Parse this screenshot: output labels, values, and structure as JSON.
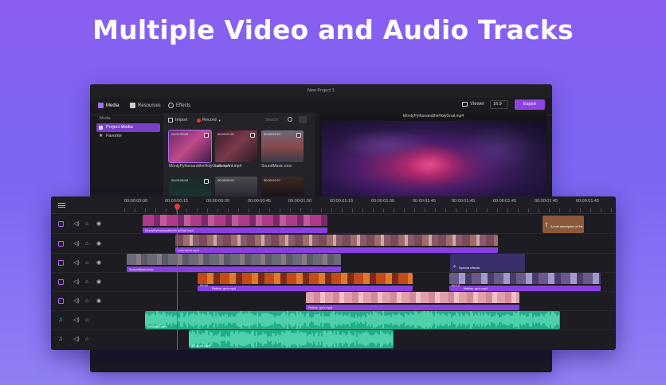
{
  "hero": {
    "title": "Multiple Video and Audio Tracks"
  },
  "window": {
    "title": "New Project 1"
  },
  "toolbar": {
    "tabs": [
      {
        "label": "Media",
        "icon": "media-icon",
        "active": true
      },
      {
        "label": "Resources",
        "icon": "resources-icon",
        "active": false
      },
      {
        "label": "Effects",
        "icon": "effects-icon",
        "active": false
      }
    ],
    "viewer_label": "Viewer",
    "ratio": "16:9",
    "export_label": "Export"
  },
  "sidebar": {
    "heading": "Media",
    "items": [
      {
        "label": "Project Media",
        "icon": "folder-icon",
        "selected": true
      },
      {
        "label": "Favorite",
        "icon": "star-icon",
        "selected": false
      }
    ]
  },
  "media": {
    "import_label": "Import",
    "record_label": "Record",
    "search_placeholder": "Search",
    "items": [
      {
        "time": "00:01:59:09",
        "name": "MontyPythonandtheHolyGrail.mp4",
        "selected": true
      },
      {
        "time": "00:00:01:01",
        "name": "Lola rennt.mp4",
        "selected": false
      },
      {
        "time": "00:00:01:07",
        "name": "SoundMusic.mov",
        "selected": false
      },
      {
        "time": "00:00:08:04",
        "name": "",
        "selected": false
      },
      {
        "time": "00:00:05:07",
        "name": "",
        "selected": false
      },
      {
        "time": "00:00:02:07",
        "name": "",
        "selected": false
      }
    ]
  },
  "preview": {
    "title": "MontyPythonandtheHolyGrail.mp4"
  },
  "timeline": {
    "ruler": [
      "00:00:00:00",
      "00:00:00:15",
      "00:00:00:30",
      "00:00:00:45",
      "00:00:01:00",
      "00:00:01:15",
      "00:00:01:30",
      "00:00:01:45",
      "00:00:01:45",
      "00:00:01:45",
      "00:00:01:45",
      "00:00:01:45"
    ],
    "clips": {
      "v1_main": "MontyPythonandtheHolyGrail.mp4",
      "v1_title": "A brief description of the",
      "v2_main": "Lola rennt.mp4",
      "v3_main": "SoundMusic.mov",
      "v3_fx": "Special effects",
      "v4_main_time": "00:10",
      "v4_main": "Rebbe, ge's mp4",
      "v4_right_time": "00:10",
      "v4_right": "Rebbe, ge's mp4",
      "v5_main": "Rebbe, ge's mp4",
      "a1_main": "Elevated.mp3",
      "a2_main": "Air drum.mp3"
    }
  },
  "colors": {
    "accent": "#8a3fe0",
    "audio": "#1fae89",
    "playhead": "#e03a3a"
  }
}
